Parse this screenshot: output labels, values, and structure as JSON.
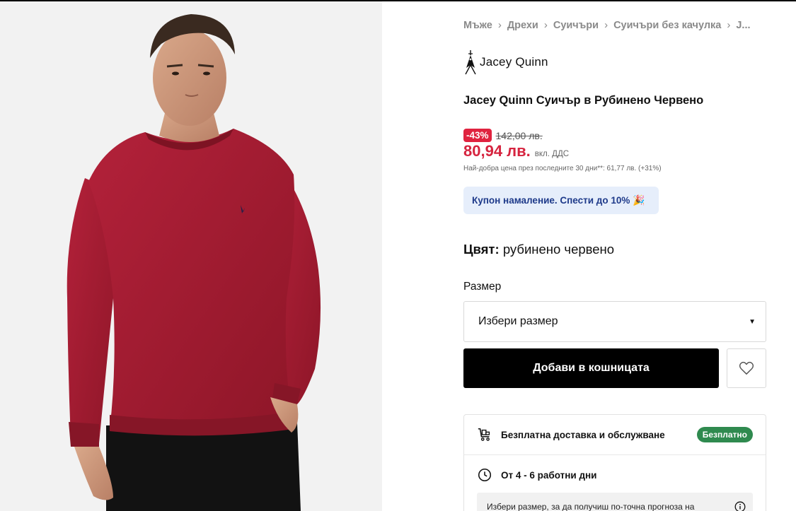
{
  "breadcrumb": [
    "Мъже",
    "Дрехи",
    "Суичъри",
    "Суичъри без качулка",
    "J..."
  ],
  "brand": {
    "name": "Jacey Quinn"
  },
  "product": {
    "title": "Jacey Quinn Суичър в Рубинено Червено"
  },
  "price": {
    "discount": "-43%",
    "old": "142,00 лв.",
    "current": "80,94 лв.",
    "vat": "вкл. ДДС",
    "best_price_note": "Най-добра цена през последните 30 дни**: 61,77 лв. (+31%)"
  },
  "coupon": {
    "text": "Купон намаление. Спести до 10%",
    "emoji": "🎉"
  },
  "color": {
    "label": "Цвят:",
    "value": "рубинено червено"
  },
  "size": {
    "label": "Размер",
    "placeholder": "Избери размер"
  },
  "actions": {
    "add_to_cart": "Добави в кошницата"
  },
  "delivery": {
    "free_text": "Безплатна доставка и обслужване",
    "free_badge": "Безплатно",
    "days_text": "От 4 - 6 работни дни",
    "forecast_text": "Избери размер, за да получиш по-точна прогноза на"
  },
  "colors": {
    "sweater": "#a31b2b",
    "price_red": "#d6243f",
    "badge_green": "#2f8a4f",
    "coupon_bg": "#e6eefb",
    "coupon_text": "#1e3a8a"
  },
  "icons": [
    "chevron-right-icon",
    "brand-logo-icon",
    "dropdown-caret-icon",
    "heart-icon",
    "delivery-cart-icon",
    "clock-icon",
    "info-icon"
  ]
}
